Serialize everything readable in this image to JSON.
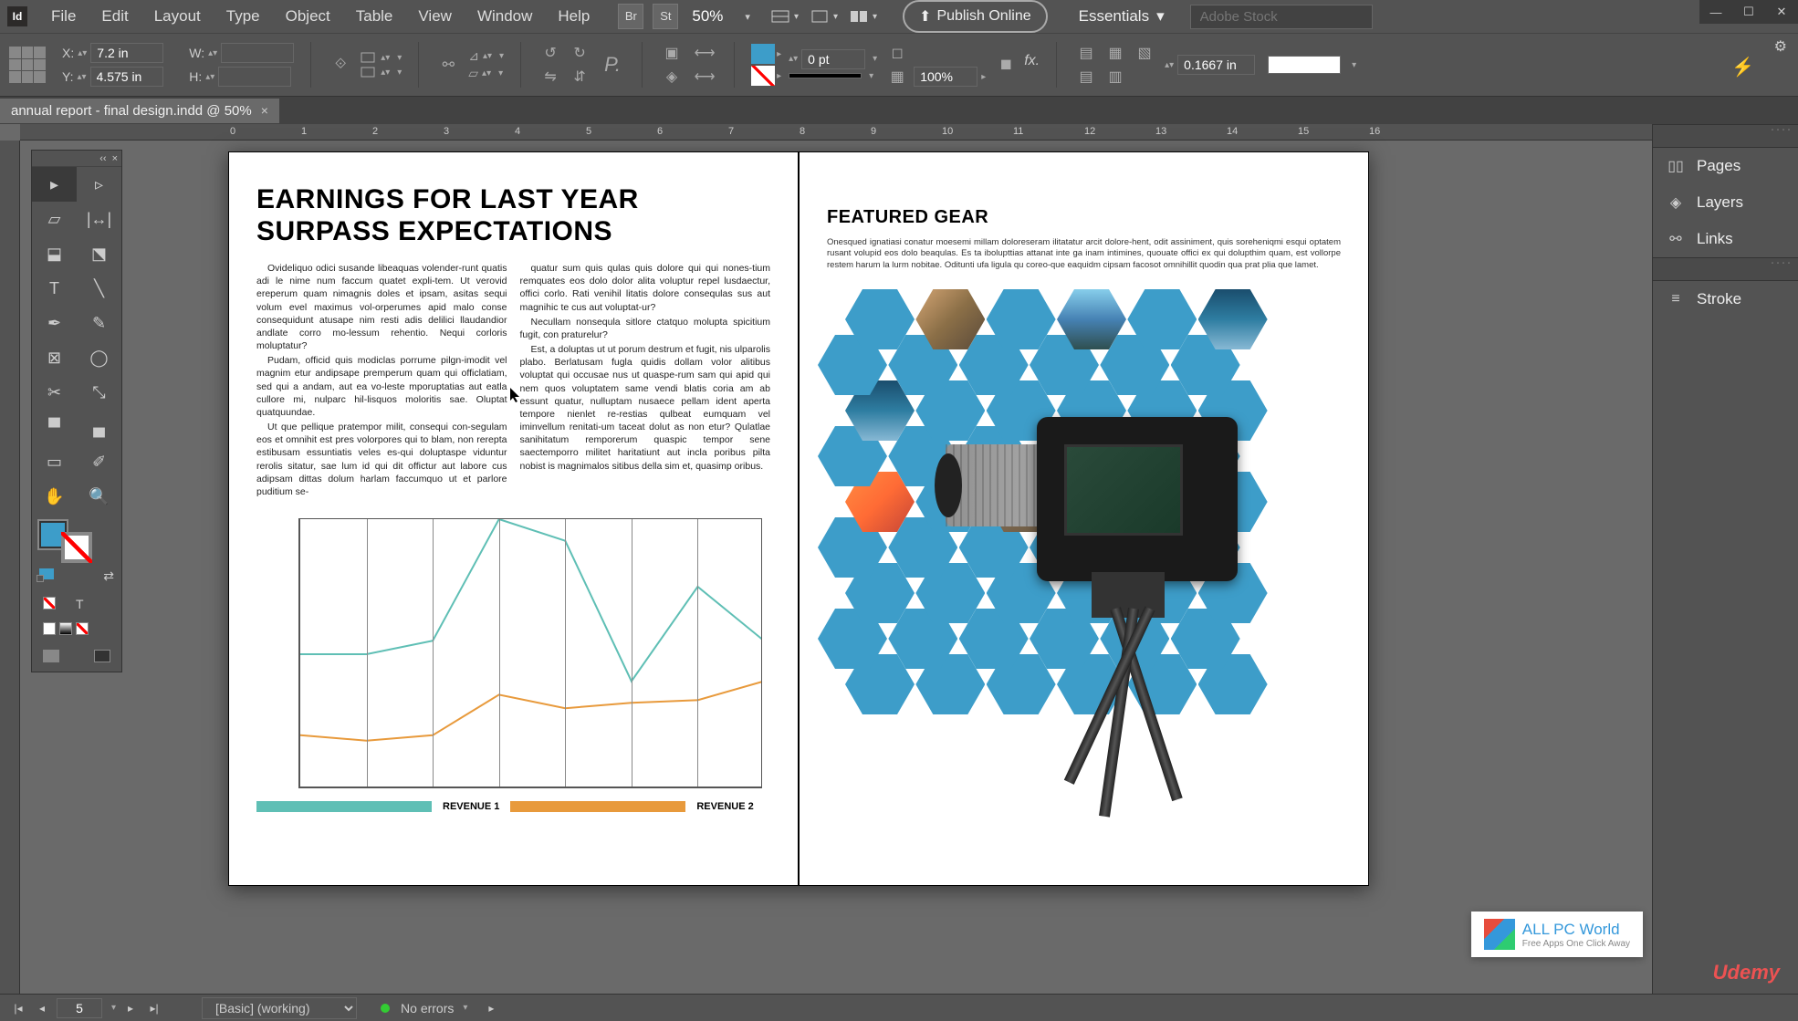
{
  "menu": [
    "File",
    "Edit",
    "Layout",
    "Type",
    "Object",
    "Table",
    "View",
    "Window",
    "Help"
  ],
  "menu_icons": [
    "Br",
    "St"
  ],
  "zoom": "50%",
  "publish": "Publish Online",
  "workspace": "Essentials",
  "stock_placeholder": "Adobe Stock",
  "control": {
    "x_label": "X:",
    "x_val": "7.2 in",
    "y_label": "Y:",
    "y_val": "4.575 in",
    "w_label": "W:",
    "w_val": "",
    "h_label": "H:",
    "h_val": "",
    "stroke_wt": "0 pt",
    "opacity": "100%",
    "inset": "0.1667 in",
    "fx": "fx."
  },
  "document_tab": "annual report - final design.indd @ 50%",
  "ruler_marks": [
    "0",
    "1",
    "2",
    "3",
    "4",
    "5",
    "6",
    "7",
    "8",
    "9",
    "10",
    "11",
    "12",
    "13",
    "14",
    "15",
    "16"
  ],
  "page_left": {
    "headline": "EARNINGS FOR LAST YEAR SURPASS EXPECTATIONS",
    "col1": [
      "Ovideliquo odici susande libeaquas volender-runt quatis adi le nime num faccum quatet expli-tem. Ut verovid ereperum quam nimagnis doles et ipsam, asitas sequi volum evel maximus vol-orperumes apid malo conse consequidunt atusape nim resti adis delilici llaudandior andlate corro mo-lessum rehentio. Nequi corloris moluptatur?",
      "Pudam, officid quis modiclas porrume pilgn-imodit vel magnim etur andipsape premperum quam qui officlatiam, sed qui a andam, aut ea vo-leste mporuptatias aut eatla cullore mi, nulparc hil-lisquos moloritis sae. Oluptat quatquundae.",
      "Ut que pellique pratempor milit, consequi con-segulam eos et omnihit est pres volorpores qui to blam, non rerepta estibusam essuntiatis veles es-qui doluptaspe viduntur rerolis sitatur, sae lum id qui dit offictur aut labore cus adipsam dittas dolum harlam faccumquo ut et parlore puditium se-"
    ],
    "col2": [
      "quatur sum quis qulas quis dolore qui qui nones-tium remquates eos dolo dolor alita voluptur repel lusdaectur, offici corlo. Rati venihil litatis dolore consequlas sus aut magnihic te cus aut voluptat-ur?",
      "Necullam nonsequla sitlore ctatquo molupta spicitium fugit, con praturelur?",
      "Est, a doluptas ut ut porum destrum et fugit, nis ulparolis plabo. Berlatusam fugla quidis dollam volor alitibus voluptat qui occusae nus ut quaspe-rum sam qui apid qui nem quos voluptatem same vendi blatis coria am ab essunt quatur, nulluptam nusaece pellam ident aperta tempore nienlet re-restias qulbeat eumquam vel iminvellum renitati-um taceat dolut as non etur? Qulatlae sanihitatum remporerum quaspic tempor sene saectemporro militet haritatiunt aut incla poribus pilta nobist is magnimalos sitibus della sim et, quasimp oribus."
    ]
  },
  "legend": {
    "r1": "REVENUE 1",
    "r2": "REVENUE 2"
  },
  "page_right": {
    "heading": "FEATURED GEAR",
    "text": "Onesqued ignatiasi conatur moesemi millam doloreseram ilitatatur arcit dolore-hent, odit assiniment, quis soreheniqmi esqui optatem rusant volupid eos dolo beaqulas. Es ta ibolupttias attanat inte ga inam intimines, quouate offici ex qui dolupthim quam, est vollorpe restem harum la lurm nobitae. Oditunti ufa ligula qu coreo-que eaquidm cipsam facosot omnihillit quodin qua prat plia que lamet."
  },
  "chart_data": {
    "type": "line",
    "x_count": 8,
    "series": [
      {
        "name": "REVENUE 1",
        "color": "#5fbfb5",
        "values": [
          50,
          50,
          55,
          100,
          92,
          40,
          75,
          55
        ]
      },
      {
        "name": "REVENUE 2",
        "color": "#e89a3c",
        "values": [
          20,
          18,
          20,
          35,
          30,
          32,
          33,
          40
        ]
      }
    ],
    "ylim": [
      0,
      100
    ]
  },
  "panels": {
    "pages": "Pages",
    "layers": "Layers",
    "links": "Links",
    "stroke": "Stroke"
  },
  "status": {
    "page": "5",
    "profile": "[Basic] (working)",
    "errors": "No errors"
  },
  "watermark": {
    "title": "ALL PC World",
    "sub": "Free Apps One Click Away"
  },
  "udemy": "Udemy"
}
